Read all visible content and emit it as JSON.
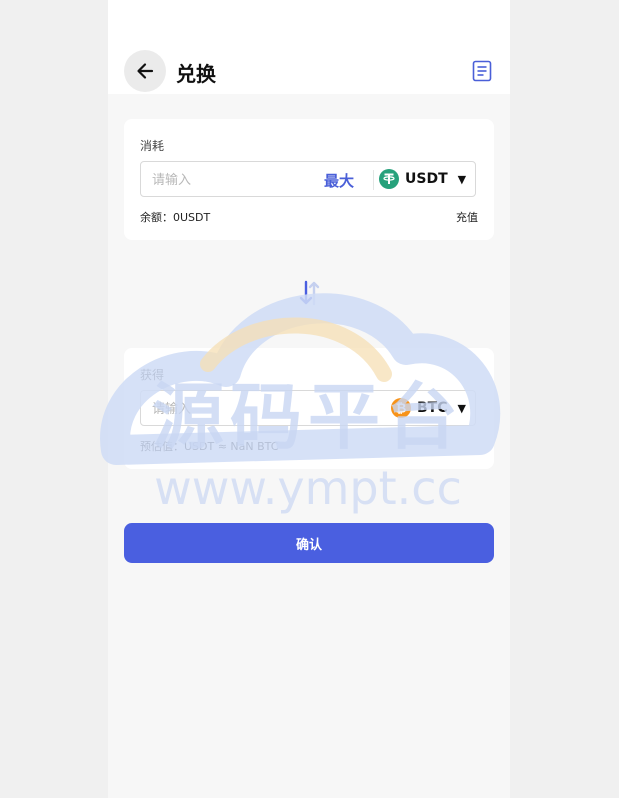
{
  "header": {
    "title": "兑换"
  },
  "spend": {
    "label": "消耗",
    "placeholder": "请输入",
    "max_label": "最大",
    "coin": "USDT",
    "balance_label": "余额：",
    "balance_value": "0USDT",
    "recharge_label": "充值"
  },
  "receive": {
    "label": "获得",
    "placeholder": "请输入",
    "coin": "BTC",
    "estimate_label": "预估值：",
    "estimate_value": "USDT ≈ NaN BTC"
  },
  "confirm_label": "确认",
  "watermark": {
    "title": "源码平台",
    "url": "www.ympt.cc"
  },
  "colors": {
    "accent": "#4a5fe0",
    "usdt": "#26a17b",
    "btc": "#f7931a"
  },
  "icons": {
    "back": "arrow-left-icon",
    "history": "document-list-icon",
    "swap": "swap-vertical-icon",
    "dropdown": "caret-down-icon"
  }
}
